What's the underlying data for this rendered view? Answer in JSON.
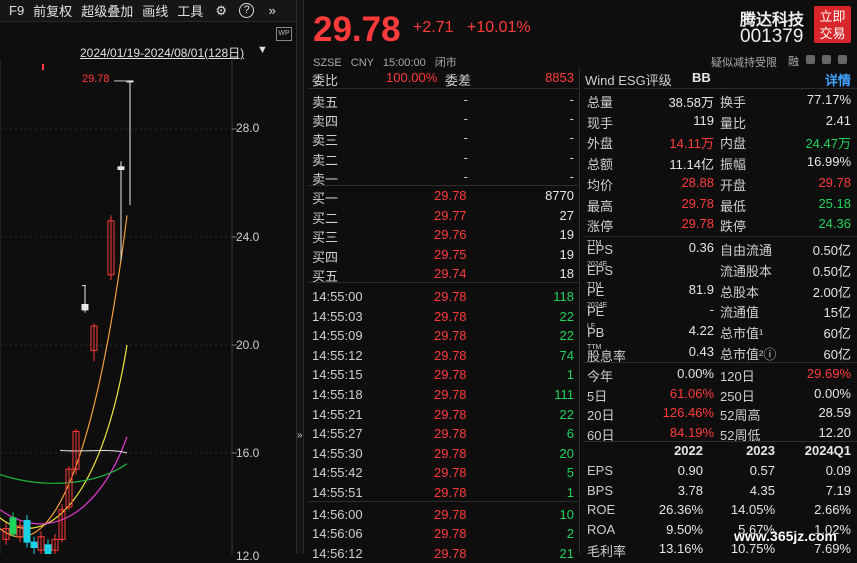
{
  "toolbar": {
    "f9": "F9",
    "restore": "前复权",
    "overlay": "超级叠加",
    "draw": "画线",
    "tools": "工具",
    "more": "»",
    "help": "?"
  },
  "chart": {
    "date_range": "2024/01/19-2024/08/01(128日)",
    "max_label": "29.78",
    "y_ticks": [
      "28.0",
      "24.0",
      "20.0",
      "16.0",
      "12.0"
    ],
    "wp": "WP"
  },
  "quote": {
    "price": "29.78",
    "change": "+2.71",
    "change_pct": "+10.01%",
    "exchange": "SZSE",
    "currency": "CNY",
    "time": "15:00:00",
    "status": "闭市",
    "name": "腾达科技",
    "code": "001379",
    "trade_label_1": "立即",
    "trade_label_2": "交易",
    "suspected": "疑似减持受限",
    "rong": "融"
  },
  "orderbook": {
    "header": {
      "wb_label": "委比",
      "wb_value": "100.00%",
      "wc_label": "委差",
      "wc_value": "8853"
    },
    "sells": [
      {
        "label": "卖五",
        "price": "-",
        "vol": "-"
      },
      {
        "label": "卖四",
        "price": "-",
        "vol": "-"
      },
      {
        "label": "卖三",
        "price": "-",
        "vol": "-"
      },
      {
        "label": "卖二",
        "price": "-",
        "vol": "-"
      },
      {
        "label": "卖一",
        "price": "-",
        "vol": "-"
      }
    ],
    "buys": [
      {
        "label": "买一",
        "price": "29.78",
        "vol": "8770"
      },
      {
        "label": "买二",
        "price": "29.77",
        "vol": "27"
      },
      {
        "label": "买三",
        "price": "29.76",
        "vol": "19"
      },
      {
        "label": "买四",
        "price": "29.75",
        "vol": "19"
      },
      {
        "label": "买五",
        "price": "29.74",
        "vol": "18"
      }
    ]
  },
  "ticks": [
    {
      "time": "14:55:00",
      "price": "29.78",
      "vol": "118"
    },
    {
      "time": "14:55:03",
      "price": "29.78",
      "vol": "22"
    },
    {
      "time": "14:55:09",
      "price": "29.78",
      "vol": "22"
    },
    {
      "time": "14:55:12",
      "price": "29.78",
      "vol": "74"
    },
    {
      "time": "14:55:15",
      "price": "29.78",
      "vol": "1"
    },
    {
      "time": "14:55:18",
      "price": "29.78",
      "vol": "111"
    },
    {
      "time": "14:55:21",
      "price": "29.78",
      "vol": "22"
    },
    {
      "time": "14:55:27",
      "price": "29.78",
      "vol": "6"
    },
    {
      "time": "14:55:30",
      "price": "29.78",
      "vol": "20"
    },
    {
      "time": "14:55:42",
      "price": "29.78",
      "vol": "5"
    },
    {
      "time": "14:55:51",
      "price": "29.78",
      "vol": "1"
    },
    {
      "time": "14:56:00",
      "price": "29.78",
      "vol": "10"
    },
    {
      "time": "14:56:06",
      "price": "29.78",
      "vol": "2"
    },
    {
      "time": "14:56:12",
      "price": "29.78",
      "vol": "21"
    }
  ],
  "stats": {
    "wind_label": "Wind ESG评级",
    "wind_rating": "BB",
    "detail": "详情",
    "rows": [
      {
        "l1": "总量",
        "v1": "38.58万",
        "c1": "wht",
        "l2": "换手",
        "v2": "77.17%",
        "c2": "wht"
      },
      {
        "l1": "现手",
        "v1": "119",
        "c1": "wht",
        "l2": "量比",
        "v2": "2.41",
        "c2": "wht"
      },
      {
        "l1": "外盘",
        "v1": "14.11万",
        "c1": "red",
        "l2": "内盘",
        "v2": "24.47万",
        "c2": "green"
      },
      {
        "l1": "总额",
        "v1": "11.14亿",
        "c1": "wht",
        "l2": "振幅",
        "v2": "16.99%",
        "c2": "wht"
      },
      {
        "l1": "均价",
        "v1": "28.88",
        "c1": "red",
        "l2": "开盘",
        "v2": "29.78",
        "c2": "red"
      },
      {
        "l1": "最高",
        "v1": "29.78",
        "c1": "red",
        "l2": "最低",
        "v2": "25.18",
        "c2": "green"
      },
      {
        "l1": "涨停",
        "v1": "29.78",
        "c1": "red",
        "l2": "跌停",
        "v2": "24.36",
        "c2": "green"
      }
    ],
    "fund": [
      {
        "l1": "EPS",
        "s1": "TTM",
        "v1": "0.36",
        "l2": "自由流通",
        "v2": "0.50亿"
      },
      {
        "l1": "EPS",
        "s1": "2024E",
        "v1": "",
        "l2": "流通股本",
        "v2": "0.50亿"
      },
      {
        "l1": "PE",
        "s1": "TTM",
        "v1": "81.9",
        "l2": "总股本",
        "v2": "2.00亿"
      },
      {
        "l1": "PE",
        "s1": "2024E",
        "v1": "-",
        "l2": "流通值",
        "v2": "15亿"
      },
      {
        "l1": "PB",
        "s1": "LF",
        "v1": "4.22",
        "l2": "总市值¹",
        "v2": "60亿"
      },
      {
        "l1": "股息率",
        "s1": "TTM",
        "v1": "0.43",
        "l2": "总市值²ⓘ",
        "v2": "60亿"
      }
    ],
    "perf": [
      {
        "l1": "今年",
        "v1": "0.00%",
        "c1": "wht",
        "l2": "120日",
        "v2": "29.69%",
        "c2": "red"
      },
      {
        "l1": "5日",
        "v1": "61.06%",
        "c1": "red",
        "l2": "250日",
        "v2": "0.00%",
        "c2": "wht"
      },
      {
        "l1": "20日",
        "v1": "126.46%",
        "c1": "red",
        "l2": "52周高",
        "v2": "28.59",
        "c2": "wht"
      },
      {
        "l1": "60日",
        "v1": "84.19%",
        "c1": "red",
        "l2": "52周低",
        "v2": "12.20",
        "c2": "wht"
      }
    ],
    "years": [
      "2022",
      "2023",
      "2024Q1"
    ],
    "fin": [
      {
        "label": "EPS",
        "vals": [
          "0.90",
          "0.57",
          "0.09"
        ]
      },
      {
        "label": "BPS",
        "vals": [
          "3.78",
          "4.35",
          "7.19"
        ]
      },
      {
        "label": "ROE",
        "vals": [
          "26.36%",
          "14.05%",
          "2.66%"
        ]
      },
      {
        "label": "ROA",
        "vals": [
          "9.50%",
          "5.67%",
          "1.02%"
        ]
      },
      {
        "label": "毛利率",
        "vals": [
          "13.16%",
          "10.75%",
          "7.69%"
        ]
      }
    ]
  },
  "watermark": "www.365jz.com"
}
